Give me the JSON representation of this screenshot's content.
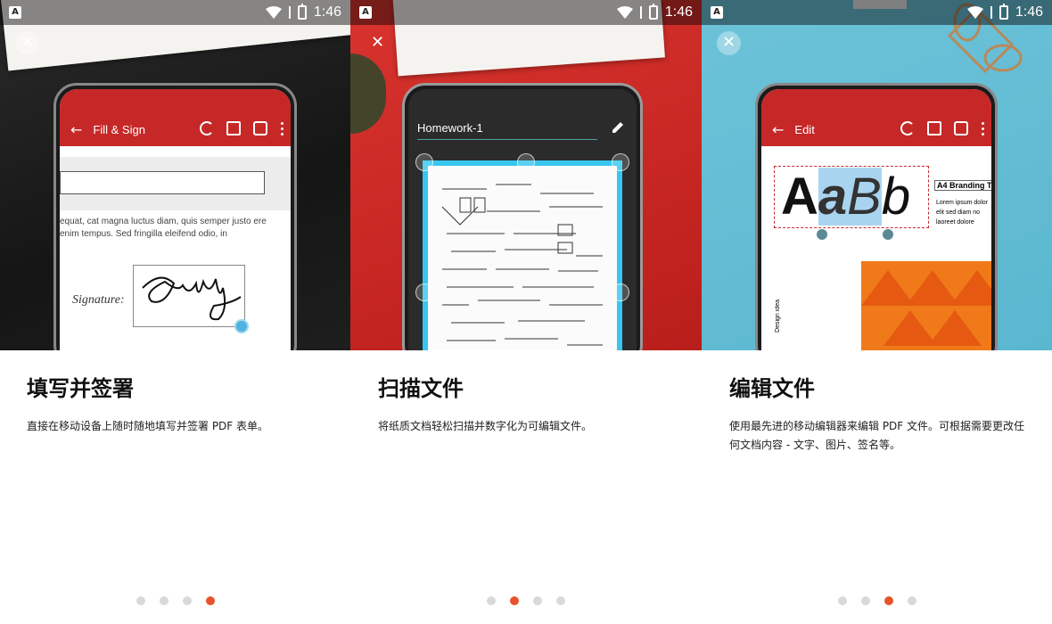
{
  "status": {
    "time": "1:46",
    "app_icon": "A"
  },
  "screens": [
    {
      "appbar_title": "Fill & Sign",
      "doc_text": "equat, cat magna luctus diam, quis semper justo ere enim tempus. Sed fringilla eleifend odio, in",
      "signature_label": "Signature:",
      "heading": "填写并签署",
      "description": "直接在移动设备上随时随地填写并签署 PDF 表单。",
      "active_dot": 3
    },
    {
      "scan_title": "Homework-1",
      "heading": "扫描文件",
      "description": "将纸质文档轻松扫描并数字化为可编辑文件。",
      "active_dot": 1
    },
    {
      "appbar_title": "Edit",
      "big_text": {
        "part1": "A",
        "part2": "a",
        "part3": "B",
        "part4": "b"
      },
      "branding": "A4 Branding T",
      "lorem_lines": [
        "Lorem ipsum dolor",
        "elit sed diam no",
        "laoreet dolore"
      ],
      "design_text": "Design idea",
      "heading": "编辑文件",
      "description": "使用最先进的移动编辑器来编辑 PDF 文件。可根据需要更改任何文档内容 - 文字、图片、签名等。",
      "active_dot": 2
    }
  ],
  "colors": {
    "accent": "#e8542c",
    "appbar": "#c62828",
    "crop": "#37c6ef"
  }
}
